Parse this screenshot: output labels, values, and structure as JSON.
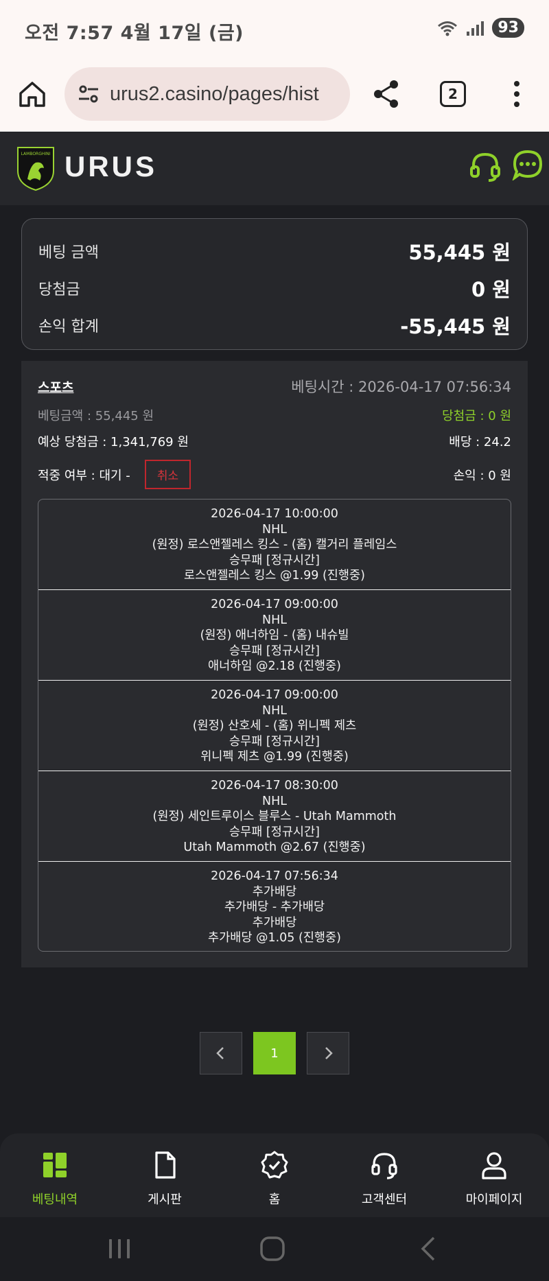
{
  "status_bar": {
    "time": "오전 7:57  4월 17일 (금)",
    "battery": "93"
  },
  "browser": {
    "url": "urus2.casino/pages/hist",
    "tab_count": "2"
  },
  "site": {
    "brand": "URUS",
    "logo_text": "LAMBORGHINI",
    "accent_color": "#8fd12a"
  },
  "summary": {
    "rows": [
      {
        "label": "베팅 금액",
        "value": "55,445 원"
      },
      {
        "label": "당첨금",
        "value": "0 원"
      },
      {
        "label": "손익 합계",
        "value": "-55,445 원"
      }
    ]
  },
  "bet": {
    "category": "스포츠",
    "bet_time": "베팅시간 : 2026-04-17 07:56:34",
    "bet_amount": "베팅금액 : 55,445 원",
    "win_amount": "당첨금 : 0 원",
    "expected_win": "예상 당첨금 : 1,341,769 원",
    "odds": "배당 : 24.2",
    "hit_status": "적중 여부 : 대기 -",
    "cancel_label": "취소",
    "profit": "손익 : 0 원",
    "games": [
      {
        "datetime": "2026-04-17 10:00:00",
        "league": "NHL",
        "match": "(원정) 로스앤젤레스 킹스 - (홈) 캘거리 플레임스",
        "market": "승무패 [정규시간]",
        "pick": "로스앤젤레스 킹스 @1.99 (진행중)"
      },
      {
        "datetime": "2026-04-17 09:00:00",
        "league": "NHL",
        "match": "(원정) 애너하임 - (홈) 내슈빌",
        "market": "승무패 [정규시간]",
        "pick": "애너하임 @2.18 (진행중)"
      },
      {
        "datetime": "2026-04-17 09:00:00",
        "league": "NHL",
        "match": "(원정) 산호세 - (홈) 위니펙 제츠",
        "market": "승무패 [정규시간]",
        "pick": "위니펙 제츠 @1.99 (진행중)"
      },
      {
        "datetime": "2026-04-17 08:30:00",
        "league": "NHL",
        "match": "(원정) 세인트루이스 블루스 - Utah Mammoth",
        "market": "승무패 [정규시간]",
        "pick": "Utah Mammoth @2.67 (진행중)"
      },
      {
        "datetime": "2026-04-17 07:56:34",
        "league": "추가배당",
        "match": "추가배당 - 추가배당",
        "market": "추가배당",
        "pick": "추가배당 @1.05 (진행중)"
      }
    ]
  },
  "pagination": {
    "current": "1"
  },
  "bottom_nav": {
    "items": [
      {
        "label": "베팅내역",
        "icon": "betting-history-icon"
      },
      {
        "label": "게시판",
        "icon": "document-icon"
      },
      {
        "label": "홈",
        "icon": "badge-check-icon"
      },
      {
        "label": "고객센터",
        "icon": "headset-icon"
      },
      {
        "label": "마이페이지",
        "icon": "user-icon"
      }
    ]
  }
}
